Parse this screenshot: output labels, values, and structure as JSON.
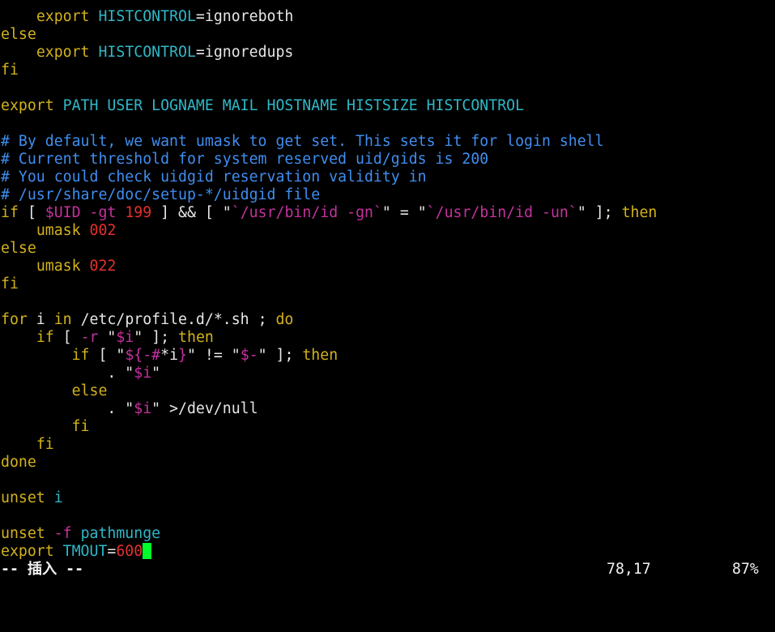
{
  "colors": {
    "normal": "#e6e6e6",
    "keyword": "#d3b21b",
    "identifier": "#2fb8c8",
    "comment": "#3f8ef0",
    "string": "#c4329d",
    "number": "#e3302d",
    "cursor": "#00ff2a"
  },
  "editor": {
    "lines": [
      [
        {
          "t": "    "
        },
        {
          "t": "export",
          "c": "keyword"
        },
        {
          "t": " "
        },
        {
          "t": "HISTCONTROL",
          "c": "identifier"
        },
        {
          "t": "=ignoreboth"
        }
      ],
      [
        {
          "t": "else",
          "c": "keyword"
        }
      ],
      [
        {
          "t": "    "
        },
        {
          "t": "export",
          "c": "keyword"
        },
        {
          "t": " "
        },
        {
          "t": "HISTCONTROL",
          "c": "identifier"
        },
        {
          "t": "=ignoredups"
        }
      ],
      [
        {
          "t": "fi",
          "c": "keyword"
        }
      ],
      [],
      [
        {
          "t": "export",
          "c": "keyword"
        },
        {
          "t": " "
        },
        {
          "t": "PATH USER LOGNAME MAIL HOSTNAME HISTSIZE HISTCONTROL",
          "c": "identifier"
        }
      ],
      [],
      [
        {
          "t": "# By default, we want umask to get set. This sets it for login shell",
          "c": "comment"
        }
      ],
      [
        {
          "t": "# Current threshold for system reserved uid/gids is 200",
          "c": "comment"
        }
      ],
      [
        {
          "t": "# You could check uidgid reservation validity in",
          "c": "comment"
        }
      ],
      [
        {
          "t": "# /usr/share/doc/setup-*/uidgid file",
          "c": "comment"
        }
      ],
      [
        {
          "t": "if",
          "c": "keyword"
        },
        {
          "t": " [ "
        },
        {
          "t": "$UID",
          "c": "string"
        },
        {
          "t": " "
        },
        {
          "t": "-gt",
          "c": "string"
        },
        {
          "t": " "
        },
        {
          "t": "199",
          "c": "number"
        },
        {
          "t": " ] && [ \""
        },
        {
          "t": "`/usr/bin/id -gn`",
          "c": "string"
        },
        {
          "t": "\" = \""
        },
        {
          "t": "`/usr/bin/id -un`",
          "c": "string"
        },
        {
          "t": "\" ]; "
        },
        {
          "t": "then",
          "c": "keyword"
        }
      ],
      [
        {
          "t": "    "
        },
        {
          "t": "umask",
          "c": "keyword"
        },
        {
          "t": " "
        },
        {
          "t": "002",
          "c": "number"
        }
      ],
      [
        {
          "t": "else",
          "c": "keyword"
        }
      ],
      [
        {
          "t": "    "
        },
        {
          "t": "umask",
          "c": "keyword"
        },
        {
          "t": " "
        },
        {
          "t": "022",
          "c": "number"
        }
      ],
      [
        {
          "t": "fi",
          "c": "keyword"
        }
      ],
      [],
      [
        {
          "t": "for",
          "c": "keyword"
        },
        {
          "t": " i "
        },
        {
          "t": "in",
          "c": "keyword"
        },
        {
          "t": " /etc/profile.d/*.sh ; "
        },
        {
          "t": "do",
          "c": "keyword"
        }
      ],
      [
        {
          "t": "    "
        },
        {
          "t": "if",
          "c": "keyword"
        },
        {
          "t": " [ "
        },
        {
          "t": "-r",
          "c": "string"
        },
        {
          "t": " \""
        },
        {
          "t": "$i",
          "c": "string"
        },
        {
          "t": "\" ]; "
        },
        {
          "t": "then",
          "c": "keyword"
        }
      ],
      [
        {
          "t": "        "
        },
        {
          "t": "if",
          "c": "keyword"
        },
        {
          "t": " [ \""
        },
        {
          "t": "${-#",
          "c": "string"
        },
        {
          "t": "*i"
        },
        {
          "t": "}",
          "c": "string"
        },
        {
          "t": "\" != \""
        },
        {
          "t": "$-",
          "c": "string"
        },
        {
          "t": "\" ]; "
        },
        {
          "t": "then",
          "c": "keyword"
        }
      ],
      [
        {
          "t": "            . \""
        },
        {
          "t": "$i",
          "c": "string"
        },
        {
          "t": "\""
        }
      ],
      [
        {
          "t": "        "
        },
        {
          "t": "else",
          "c": "keyword"
        }
      ],
      [
        {
          "t": "            . \""
        },
        {
          "t": "$i",
          "c": "string"
        },
        {
          "t": "\" >/dev/null"
        }
      ],
      [
        {
          "t": "        "
        },
        {
          "t": "fi",
          "c": "keyword"
        }
      ],
      [
        {
          "t": "    "
        },
        {
          "t": "fi",
          "c": "keyword"
        }
      ],
      [
        {
          "t": "done",
          "c": "keyword"
        }
      ],
      [],
      [
        {
          "t": "unset",
          "c": "keyword"
        },
        {
          "t": " "
        },
        {
          "t": "i",
          "c": "identifier"
        }
      ],
      [],
      [
        {
          "t": "unset",
          "c": "keyword"
        },
        {
          "t": " "
        },
        {
          "t": "-f",
          "c": "string"
        },
        {
          "t": " "
        },
        {
          "t": "pathmunge",
          "c": "identifier"
        }
      ],
      [
        {
          "t": "export",
          "c": "keyword"
        },
        {
          "t": " "
        },
        {
          "t": "TMOUT",
          "c": "identifier"
        },
        {
          "t": "="
        },
        {
          "t": "600",
          "c": "number"
        },
        {
          "cursor": true
        }
      ]
    ]
  },
  "status": {
    "mode": "-- 插入 --",
    "position": "78,17",
    "percent": "87%"
  }
}
